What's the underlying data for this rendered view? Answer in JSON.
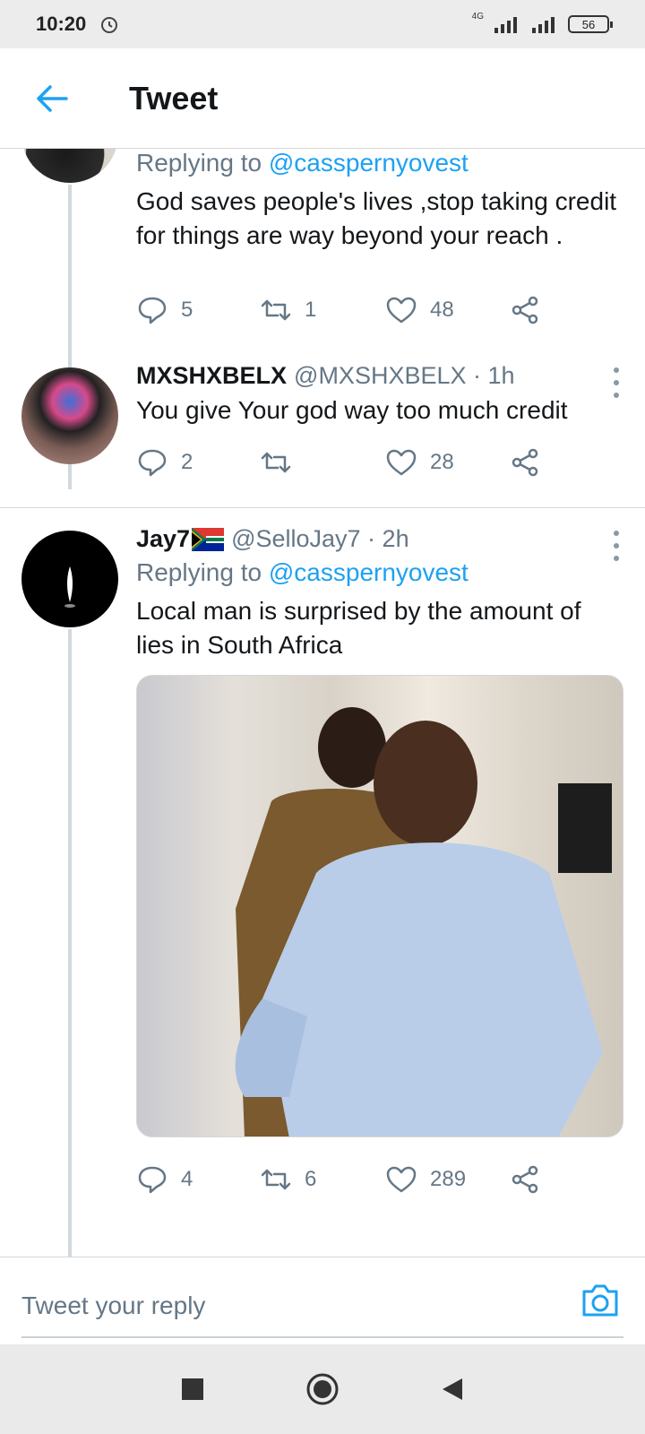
{
  "status_bar": {
    "time": "10:20",
    "network": "4G",
    "battery": "56"
  },
  "header": {
    "title": "Tweet"
  },
  "tweets": [
    {
      "replying_prefix": "Replying to",
      "mention": "@casspernyovest",
      "text": "God saves people's lives ,stop taking credit for things are way beyond your reach .",
      "replies": "5",
      "retweets": "1",
      "likes": "48"
    },
    {
      "display_name": "MXSHXBELX",
      "handle": "@MXSHXBELX · 1h",
      "text": "You give Your god way too much credit",
      "replies": "2",
      "retweets": "",
      "likes": "28"
    },
    {
      "display_name": "Jay7",
      "handle": "@SelloJay7 · 2h",
      "replying_prefix": "Replying to",
      "mention": "@casspernyovest",
      "text": "Local man is surprised by the amount of lies in South Africa",
      "replies": "4",
      "retweets": "6",
      "likes": "289"
    }
  ],
  "reply_bar": {
    "placeholder": "Tweet your reply"
  },
  "colors": {
    "accent": "#1da1f2",
    "secondary_text": "#657786",
    "thread_line": "#cfd9de"
  },
  "icons": [
    "back-arrow-icon",
    "alarm-icon",
    "reply-icon",
    "retweet-icon",
    "like-icon",
    "share-icon",
    "more-icon",
    "camera-icon",
    "nav-square-icon",
    "nav-home-icon",
    "nav-back-icon"
  ]
}
